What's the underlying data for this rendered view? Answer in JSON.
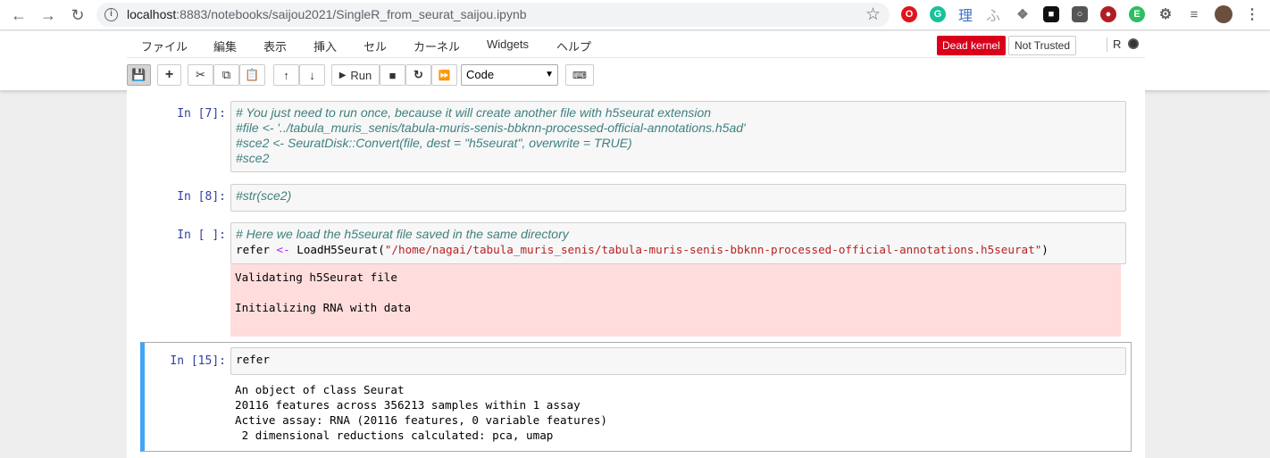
{
  "browser": {
    "url_host": "localhost",
    "url_rest": ":8883/notebooks/saijou2021/SingleR_from_seurat_saijou.ipynb",
    "ext_labels": [
      "理",
      "ふ"
    ]
  },
  "menubar": {
    "items": [
      "ファイル",
      "編集",
      "表示",
      "挿入",
      "セル",
      "カーネル",
      "Widgets",
      "ヘルプ"
    ],
    "kernel_status": "Dead kernel",
    "trust_status": "Not Trusted",
    "kernel_name": "R"
  },
  "toolbar": {
    "run_label": "Run",
    "cell_type": "Code"
  },
  "cells": {
    "c7": {
      "prompt": "In [7]:",
      "lines": [
        "# You just need to run once, because it will create another file with h5seurat extension",
        "#file <- '../tabula_muris_senis/tabula-muris-senis-bbknn-processed-official-annotations.h5ad'",
        "#sce2 <- SeuratDisk::Convert(file, dest = \"h5seurat\", overwrite = TRUE)",
        "#sce2"
      ]
    },
    "c8": {
      "prompt": "In [8]:",
      "line": "#str(sce2)"
    },
    "c9": {
      "prompt": "In [ ]:",
      "comment": "# Here we load the h5seurat file saved in the same directory",
      "code_var": "refer ",
      "code_op": "<-",
      "code_fn": " LoadH5Seurat(",
      "code_str": "\"/home/nagai/tabula_muris_senis/tabula-muris-senis-bbknn-processed-official-annotations.h5seurat\"",
      "code_end": ")",
      "stderr_1": "Validating h5Seurat file",
      "stderr_2": "Initializing RNA with data"
    },
    "c15": {
      "prompt": "In [15]:",
      "code": "refer",
      "output": [
        "An object of class Seurat",
        "20116 features across 356213 samples within 1 assay",
        "Active assay: RNA (20116 features, 0 variable features)",
        " 2 dimensional reductions calculated: pca, umap"
      ]
    }
  }
}
